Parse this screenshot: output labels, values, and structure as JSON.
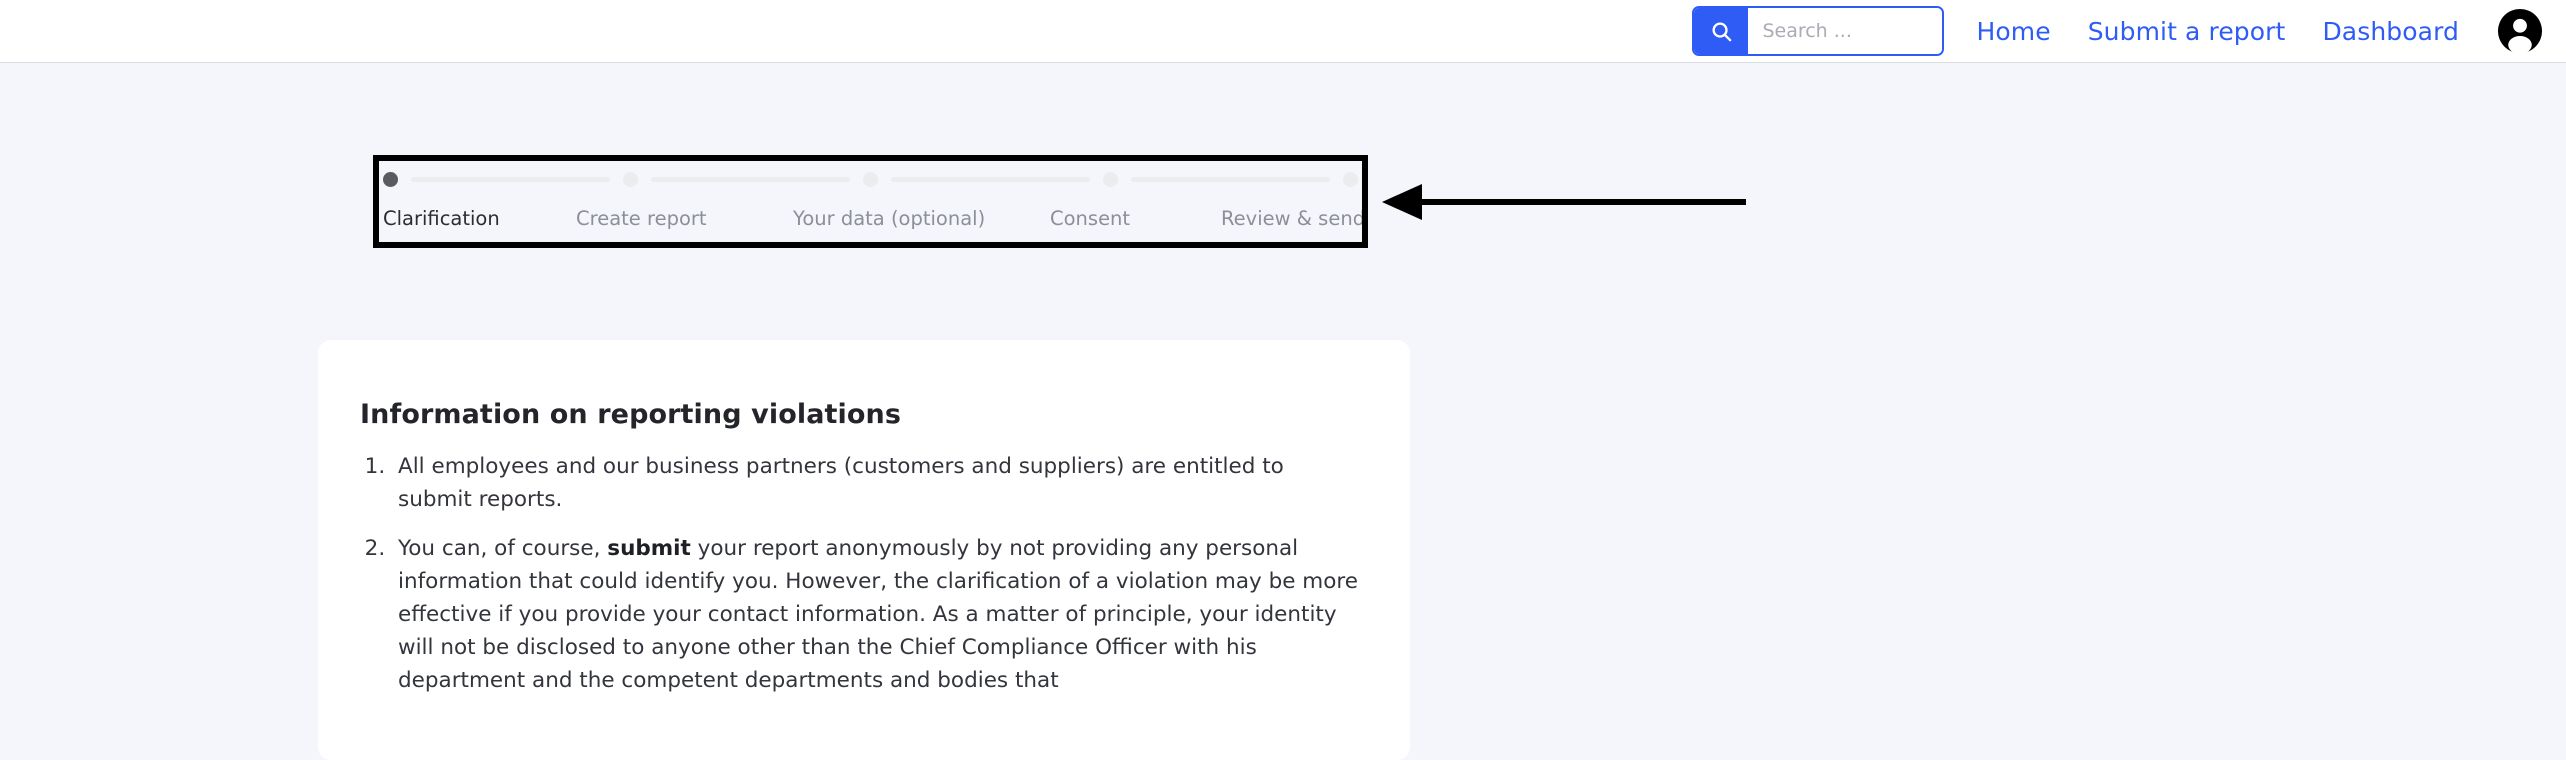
{
  "header": {
    "search": {
      "icon": "search-icon",
      "placeholder": "Search ...",
      "value": ""
    },
    "nav_links": [
      {
        "label": "Home"
      },
      {
        "label": "Submit a report"
      },
      {
        "label": "Dashboard"
      }
    ],
    "avatar_icon": "user-avatar-icon",
    "accent_color": "#2f5cf5"
  },
  "annotation": {
    "highlight_box": "stepper-highlight-rectangle",
    "arrow": "left-pointing-arrow",
    "color": "#000000"
  },
  "stepper": {
    "active_index": 0,
    "steps": [
      {
        "label": "Clarification"
      },
      {
        "label": "Create report"
      },
      {
        "label": "Your data (optional)"
      },
      {
        "label": "Consent"
      },
      {
        "label": "Review & send"
      }
    ],
    "active_dot_color": "#5a5a61",
    "inactive_dot_color": "#ececee"
  },
  "card": {
    "title": "Information on reporting violations",
    "items": [
      {
        "before": "All employees and our business partners (customers and suppliers) are entitled to submit reports.",
        "bold": "",
        "after": ""
      },
      {
        "before": "You can, of course, ",
        "bold": "submit",
        "after": " your report anonymously by not providing any personal information that could identify you. However, the clarification of a violation may be more effective if you provide your contact information. As a matter of principle, your identity will not be disclosed to anyone other than the Chief Compliance Officer with his department and the competent departments and bodies that"
      }
    ]
  }
}
